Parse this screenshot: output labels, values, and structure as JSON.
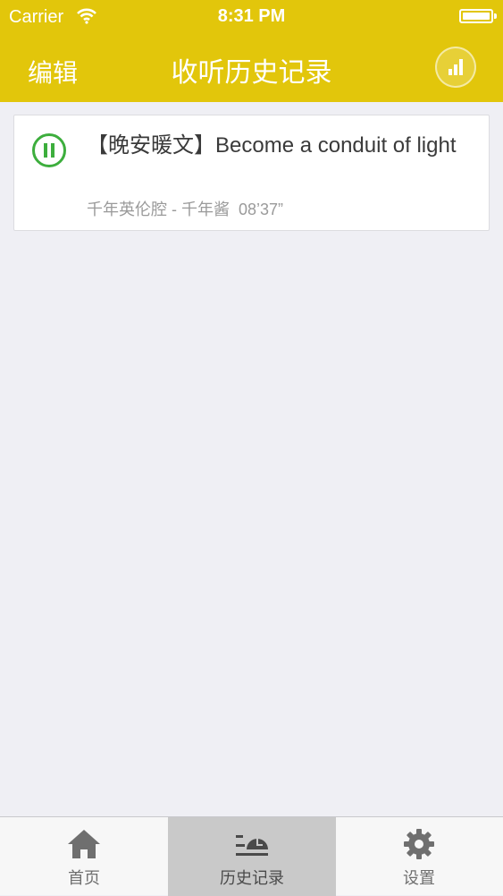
{
  "status_bar": {
    "carrier": "Carrier",
    "time": "8:31 PM"
  },
  "nav": {
    "edit_label": "编辑",
    "title": "收听历史记录",
    "now_playing_icon": "equalizer-bars-icon"
  },
  "history": {
    "items": [
      {
        "title": "【晚安暖文】Become a conduit of light",
        "meta": "千年英伦腔 - 千年酱  08’37”",
        "state": "playing",
        "icon": "pause-icon"
      }
    ]
  },
  "tabs": [
    {
      "label": "首页",
      "icon": "home-icon",
      "active": false
    },
    {
      "label": "历史记录",
      "icon": "history-icon",
      "active": true
    },
    {
      "label": "设置",
      "icon": "gear-icon",
      "active": false
    }
  ],
  "colors": {
    "header": "#e2c60b",
    "accent_green": "#3dae3d",
    "background": "#efeff4"
  }
}
